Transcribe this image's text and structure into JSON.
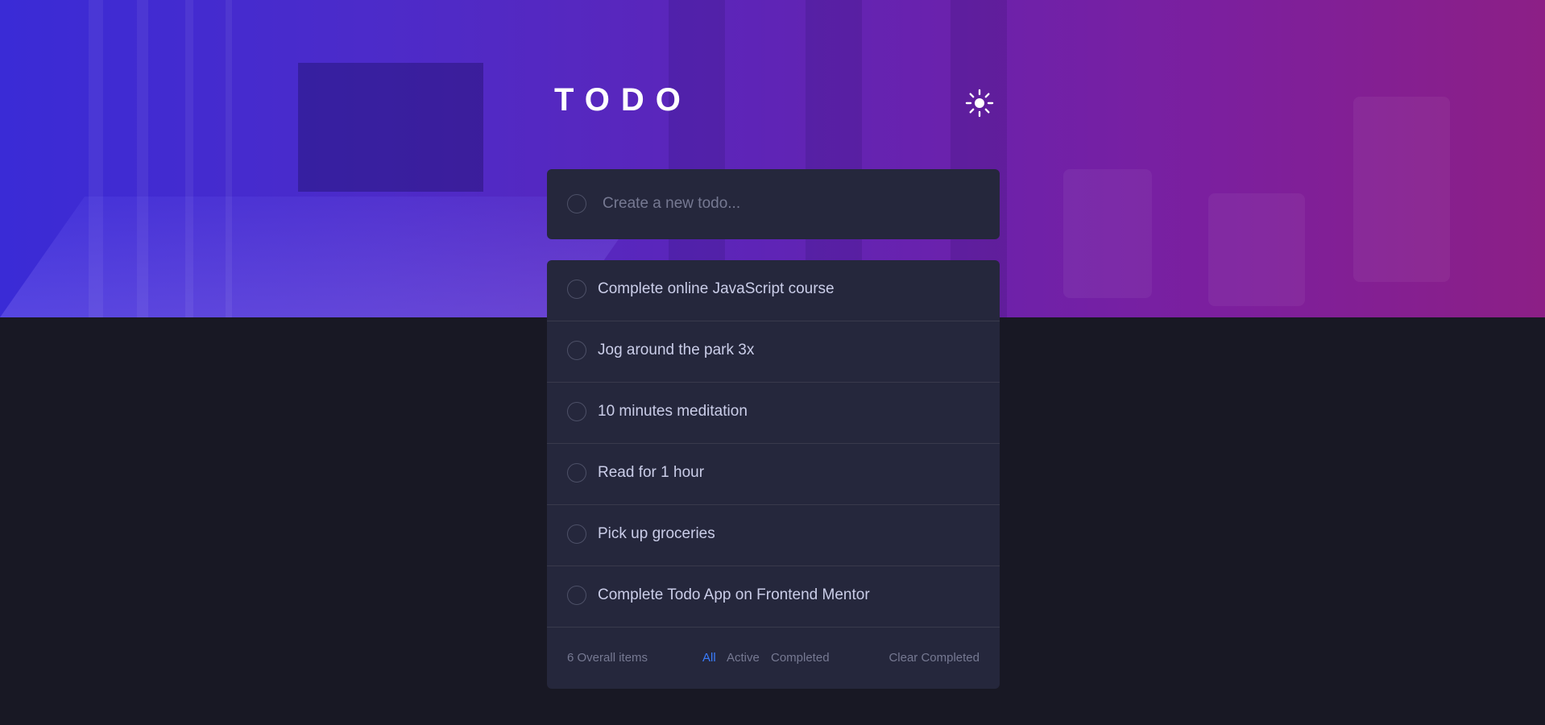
{
  "header": {
    "title": "TODO",
    "theme_toggle_icon": "sun-icon"
  },
  "new_todo": {
    "placeholder": "Create a new todo..."
  },
  "todos": [
    {
      "text": "Complete online JavaScript course",
      "completed": false
    },
    {
      "text": "Jog around the park 3x",
      "completed": false
    },
    {
      "text": "10 minutes meditation",
      "completed": false
    },
    {
      "text": "Read for 1 hour",
      "completed": false
    },
    {
      "text": "Pick up groceries",
      "completed": false
    },
    {
      "text": "Complete Todo App on Frontend Mentor",
      "completed": false
    }
  ],
  "footer": {
    "count_label": "6 Overall items",
    "filters": [
      {
        "label": "All",
        "active": true
      },
      {
        "label": "Active",
        "active": false
      },
      {
        "label": "Completed",
        "active": false
      }
    ],
    "clear_label": "Clear Completed"
  },
  "colors": {
    "background": "#181824",
    "card": "#25273c",
    "text": "#cacde8",
    "muted": "#767992",
    "accent": "#3a7cfd",
    "gradient_start": "#3a2bd6",
    "gradient_end": "#8c1f86"
  }
}
